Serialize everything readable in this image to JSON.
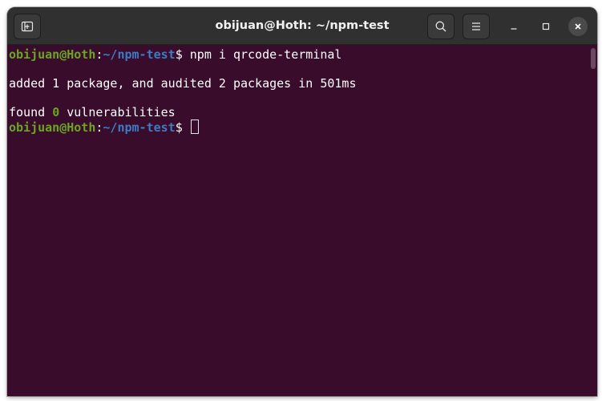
{
  "window": {
    "title": "obijuan@Hoth: ~/npm-test"
  },
  "titlebar": {
    "new_tab_icon": "new-tab-icon",
    "search_icon": "search-icon",
    "menu_icon": "hamburger-menu-icon",
    "minimize_icon": "minimize-icon",
    "maximize_icon": "maximize-icon",
    "close_icon": "close-icon"
  },
  "terminal": {
    "lines": [
      {
        "user_host": "obijuan@Hoth",
        "colon": ":",
        "path": "~/npm-test",
        "prompt": "$ ",
        "command": "npm i qrcode-terminal"
      },
      {
        "text": "added 1 package, and audited 2 packages in 501ms"
      },
      {
        "text_before": "found ",
        "count": "0",
        "text_after": " vulnerabilities"
      },
      {
        "user_host": "obijuan@Hoth",
        "colon": ":",
        "path": "~/npm-test",
        "prompt": "$ ",
        "command": ""
      }
    ]
  },
  "colors": {
    "terminal_bg": "#380c2a",
    "titlebar_bg": "#303030",
    "user_host": "#6ba522",
    "path": "#3d7bc5",
    "text": "#ffffff"
  }
}
